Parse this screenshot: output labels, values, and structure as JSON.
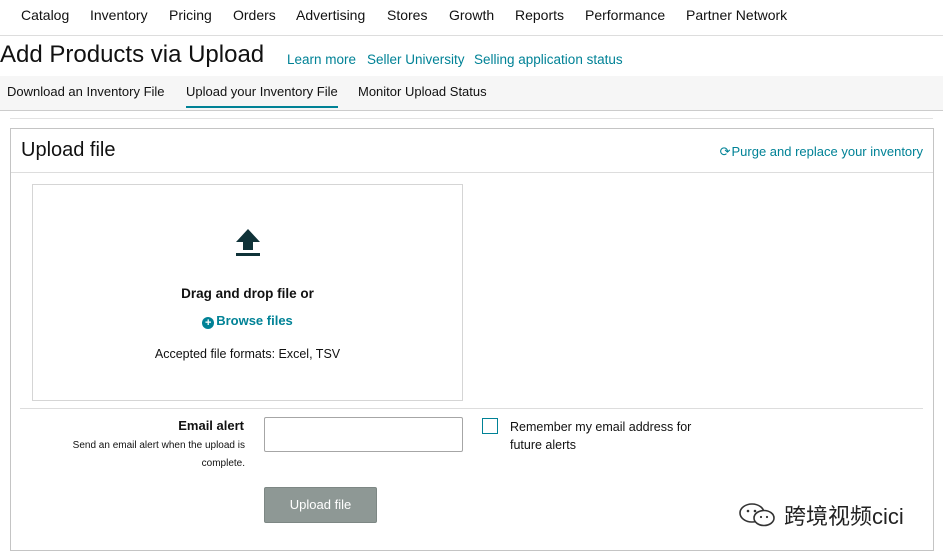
{
  "topnav": {
    "items": [
      "Catalog",
      "Inventory",
      "Pricing",
      "Orders",
      "Advertising",
      "Stores",
      "Growth",
      "Reports",
      "Performance",
      "Partner Network"
    ]
  },
  "header": {
    "title": "Add Products via Upload",
    "links": [
      "Learn more",
      "Seller University",
      "Selling application status"
    ]
  },
  "subnav": {
    "tabs": [
      "Download an Inventory File",
      "Upload your Inventory File",
      "Monitor Upload Status"
    ],
    "active_tab": "Upload your Inventory File"
  },
  "panel": {
    "title": "Upload file",
    "purge_link": "Purge and replace your inventory",
    "purge_icon": "refresh-icon",
    "dropzone": {
      "icon": "upload-icon",
      "title": "Drag and drop file or",
      "browse_label": "Browse files",
      "browse_icon": "plus-circle-icon",
      "formats": "Accepted file formats: Excel, TSV"
    },
    "email": {
      "label": "Email alert",
      "help": "Send an email alert when the upload is complete.",
      "value": "",
      "remember_label": "Remember my email address for future alerts",
      "remember_checked": false
    },
    "upload_button": "Upload file"
  },
  "watermark": {
    "text": "跨境视频cici",
    "icon": "wechat-icon"
  },
  "colors": {
    "link": "#008296",
    "button_disabled": "#8e9895",
    "tab_underline": "#008296"
  }
}
